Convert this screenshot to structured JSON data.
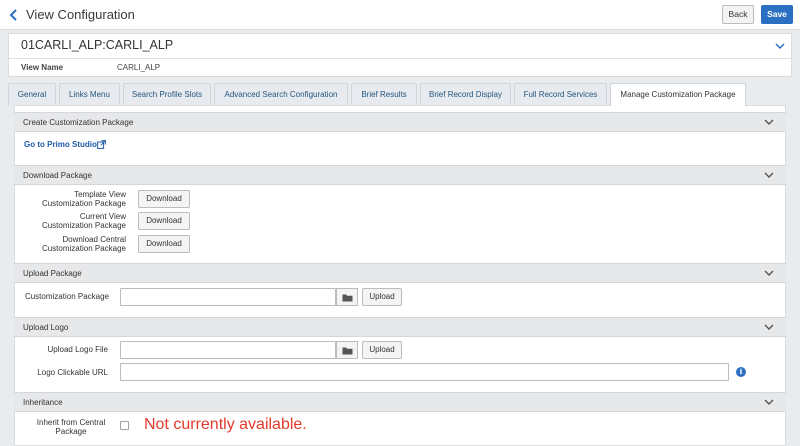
{
  "header": {
    "title": "View Configuration",
    "back_label": "Back",
    "save_label": "Save",
    "back_icon": "chevron-left-icon"
  },
  "record": {
    "id": "01CARLI_ALP:CARLI_ALP",
    "view_name_label": "View Name",
    "view_name_value": "CARLI_ALP"
  },
  "tabs": [
    {
      "label": "General"
    },
    {
      "label": "Links Menu"
    },
    {
      "label": "Search Profile Slots"
    },
    {
      "label": "Advanced Search Configuration"
    },
    {
      "label": "Brief Results"
    },
    {
      "label": "Brief Record Display"
    },
    {
      "label": "Full Record Services"
    },
    {
      "label": "Manage Customization Package",
      "active": true
    }
  ],
  "sections": {
    "create": {
      "title": "Create Customization Package",
      "link_label": "Go to Primo Studio"
    },
    "download": {
      "title": "Download Package",
      "rows": [
        {
          "label_line1": "Template View",
          "label_line2": "Customization Package",
          "button": "Download"
        },
        {
          "label_line1": "Current View",
          "label_line2": "Customization Package",
          "button": "Download"
        },
        {
          "label_line1": "Download Central",
          "label_line2": "Customization Package",
          "button": "Download"
        }
      ]
    },
    "upload_package": {
      "title": "Upload Package",
      "field_label": "Customization Package",
      "field_value": "",
      "upload_label": "Upload"
    },
    "upload_logo": {
      "title": "Upload Logo",
      "file_label": "Upload Logo File",
      "file_value": "",
      "upload_label": "Upload",
      "url_label": "Logo Clickable URL",
      "url_value": ""
    },
    "inheritance": {
      "title": "Inheritance",
      "label_line1": "Inherit from Central",
      "label_line2": "Package",
      "checked": false,
      "note": "Not currently available."
    }
  },
  "colors": {
    "accent": "#2a6fc2",
    "link": "#1f5aa6",
    "warning_text": "#e23a2c"
  }
}
